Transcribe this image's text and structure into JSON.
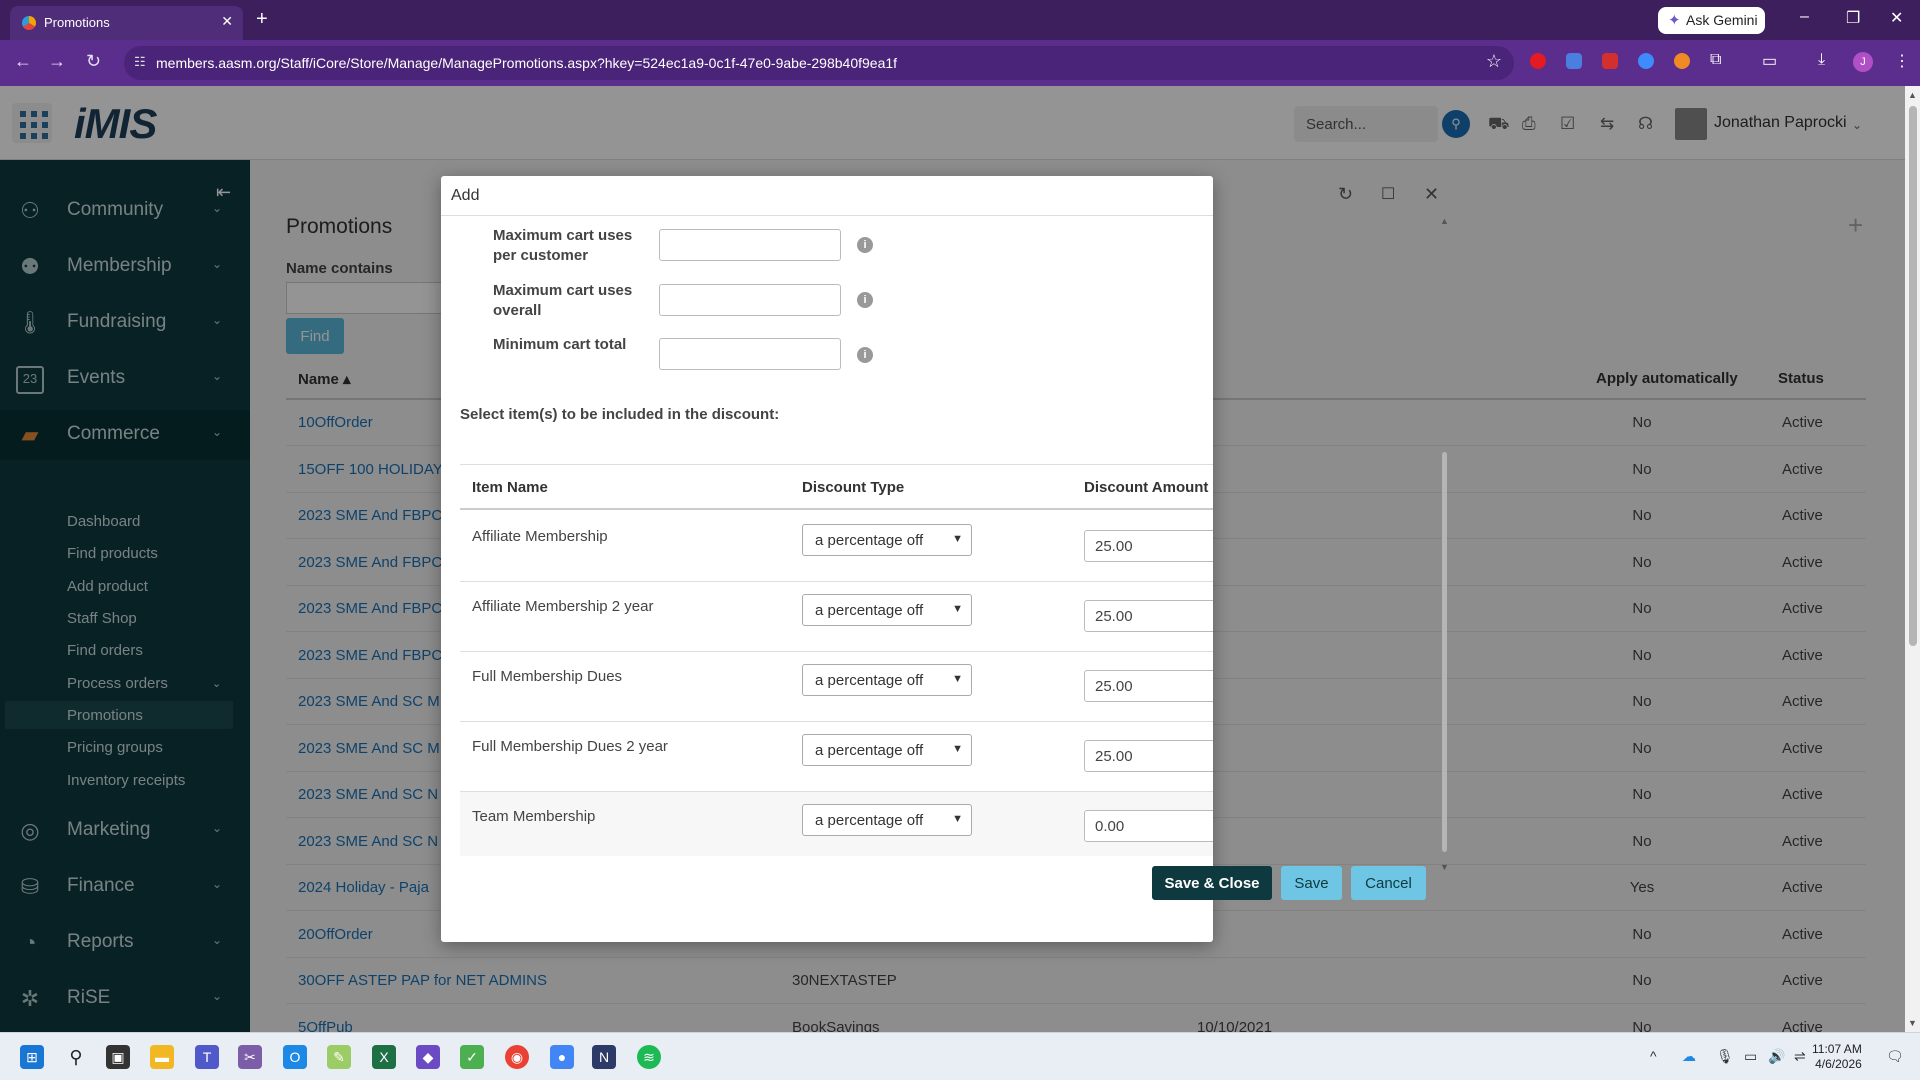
{
  "browser": {
    "tab_title": "Promotions",
    "tab_close": "✕",
    "new_tab": "+",
    "gemini_label": "Ask Gemini",
    "url": "members.aasm.org/Staff/iCore/Store/Manage/ManagePromotions.aspx?hkey=524ec1a9-0c1f-47e0-9abe-298b40f9ea1f",
    "profile_initial": "J"
  },
  "header": {
    "logo": "iMIS",
    "search_placeholder": "Search...",
    "user_name": "Jonathan Paprocki"
  },
  "sidebar": {
    "items": [
      {
        "label": "Community",
        "icon": "community-icon"
      },
      {
        "label": "Membership",
        "icon": "membership-icon"
      },
      {
        "label": "Fundraising",
        "icon": "fundraising-icon"
      },
      {
        "label": "Events",
        "icon": "calendar-icon"
      },
      {
        "label": "Commerce",
        "icon": "commerce-icon"
      },
      {
        "label": "Marketing",
        "icon": "marketing-icon"
      },
      {
        "label": "Finance",
        "icon": "finance-icon"
      },
      {
        "label": "Reports",
        "icon": "reports-icon"
      },
      {
        "label": "RiSE",
        "icon": "rise-icon"
      }
    ],
    "commerce_sub": [
      "Dashboard",
      "Find products",
      "Add product",
      "Staff Shop",
      "Find orders",
      "Process orders",
      "Promotions",
      "Pricing groups",
      "Inventory receipts"
    ],
    "events_day": "23"
  },
  "main": {
    "title": "Promotions",
    "name_contains_label": "Name contains",
    "find_button": "Find",
    "col_name": "Name ▴",
    "col_apply": "Apply automatically",
    "col_status": "Status",
    "rows": [
      {
        "name": "10OffOrder",
        "code": "",
        "date": "",
        "apply": "No",
        "status": "Active"
      },
      {
        "name": "15OFF 100 HOLIDAY",
        "code": "",
        "date": "",
        "apply": "No",
        "status": "Active"
      },
      {
        "name": "2023 SME And FBPC",
        "code": "",
        "date": "",
        "apply": "No",
        "status": "Active"
      },
      {
        "name": "2023 SME And FBPC",
        "code": "",
        "date": "",
        "apply": "No",
        "status": "Active"
      },
      {
        "name": "2023 SME And FBPC",
        "code": "",
        "date": "",
        "apply": "No",
        "status": "Active"
      },
      {
        "name": "2023 SME And FBPC",
        "code": "",
        "date": "",
        "apply": "No",
        "status": "Active"
      },
      {
        "name": "2023 SME And SC M",
        "code": "",
        "date": "",
        "apply": "No",
        "status": "Active"
      },
      {
        "name": "2023 SME And SC M",
        "code": "",
        "date": "",
        "apply": "No",
        "status": "Active"
      },
      {
        "name": "2023 SME And SC N",
        "code": "",
        "date": "",
        "apply": "No",
        "status": "Active"
      },
      {
        "name": "2023 SME And SC N",
        "code": "",
        "date": "",
        "apply": "No",
        "status": "Active"
      },
      {
        "name": "2024 Holiday - Paja",
        "code": "",
        "date": "",
        "apply": "Yes",
        "status": "Active"
      },
      {
        "name": "20OffOrder",
        "code": "",
        "date": "",
        "apply": "No",
        "status": "Active"
      },
      {
        "name": "30OFF ASTEP PAP for NET ADMINS",
        "code": "30NEXTASTEP",
        "date": "",
        "apply": "No",
        "status": "Active"
      },
      {
        "name": "5OffPub",
        "code": "BookSavings",
        "date": "10/10/2021",
        "apply": "No",
        "status": "Active"
      }
    ]
  },
  "modal": {
    "title": "Add",
    "fields": [
      {
        "label": "Maximum cart uses per customer",
        "value": "",
        "info": "i"
      },
      {
        "label": "Maximum cart uses overall",
        "value": "",
        "info": "i"
      },
      {
        "label": "Minimum cart total",
        "value": "",
        "info": "i"
      }
    ],
    "select_items_label": "Select item(s) to be included in the discount:",
    "col_item_name": "Item Name",
    "col_discount_type": "Discount Type",
    "col_discount_amount": "Discount Amount",
    "items": [
      {
        "name": "Affiliate Membership",
        "type": "a percentage off",
        "amount": "25.00"
      },
      {
        "name": "Affiliate Membership 2 year",
        "type": "a percentage off",
        "amount": "25.00"
      },
      {
        "name": "Full Membership Dues",
        "type": "a percentage off",
        "amount": "25.00"
      },
      {
        "name": "Full Membership Dues 2 year",
        "type": "a percentage off",
        "amount": "25.00"
      },
      {
        "name": "Team Membership",
        "type": "a percentage off",
        "amount": "0.00"
      }
    ],
    "save_close": "Save & Close",
    "save": "Save",
    "cancel": "Cancel"
  },
  "taskbar": {
    "time": "11:07 AM",
    "date": "4/6/2026"
  },
  "colors": {
    "sidebar_bg": "#0e3a3f",
    "browser_purple": "#5b2d8c",
    "link_blue": "#1a73b8",
    "primary_button": "#0e3a3f",
    "secondary_button": "#6ec6e4"
  }
}
